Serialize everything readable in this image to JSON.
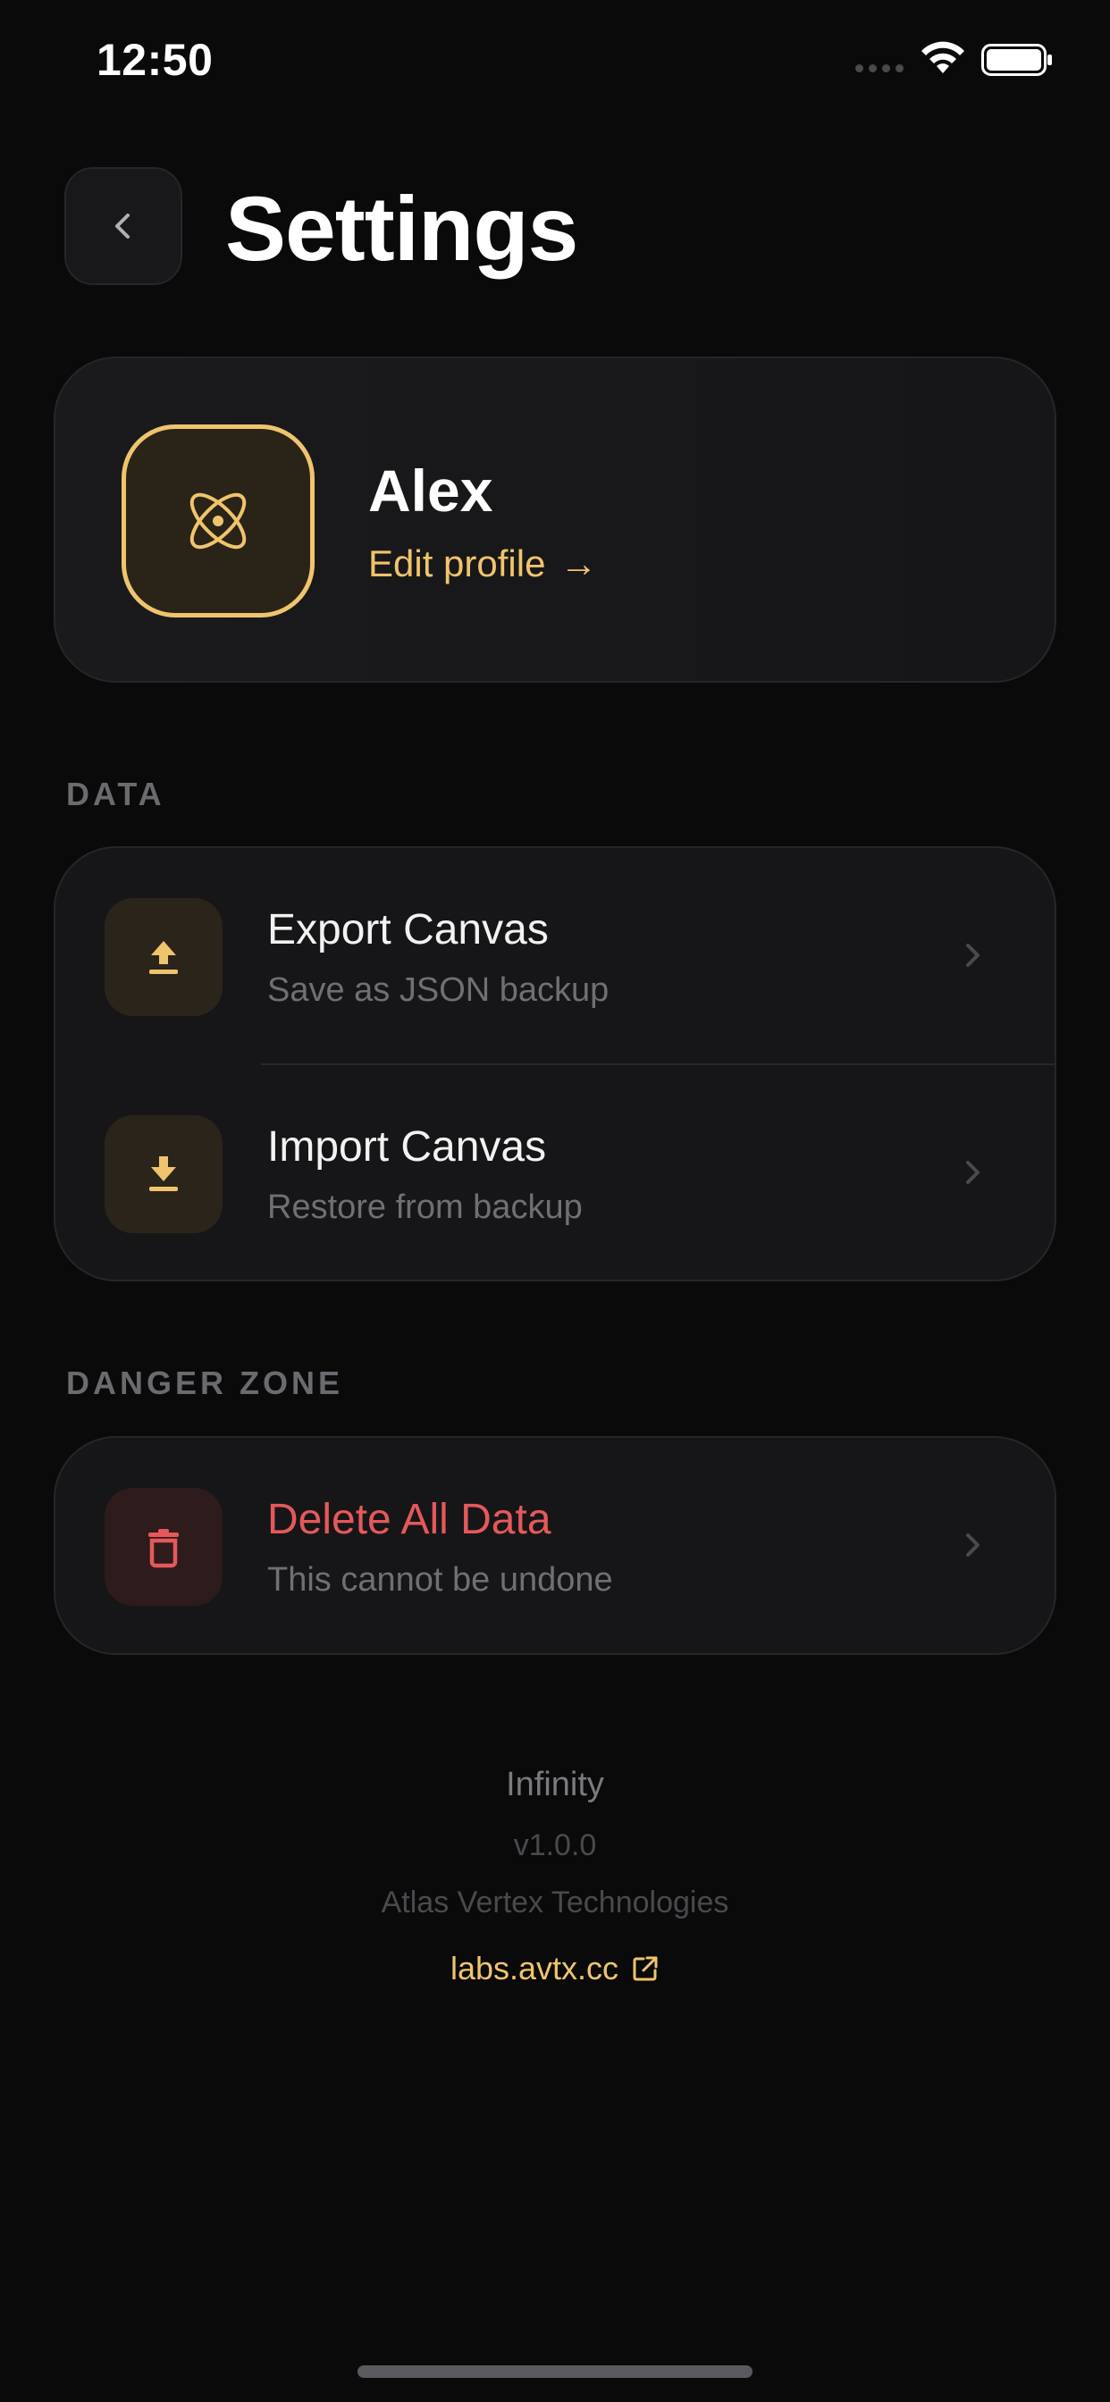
{
  "status_bar": {
    "time": "12:50"
  },
  "header": {
    "title": "Settings"
  },
  "profile": {
    "name": "Alex",
    "edit_label": "Edit profile",
    "edit_arrow": "→"
  },
  "sections": {
    "data": {
      "label": "DATA",
      "items": [
        {
          "title": "Export Canvas",
          "subtitle": "Save as JSON backup",
          "icon": "upload-icon"
        },
        {
          "title": "Import Canvas",
          "subtitle": "Restore from backup",
          "icon": "download-icon"
        }
      ]
    },
    "danger": {
      "label": "DANGER ZONE",
      "items": [
        {
          "title": "Delete All Data",
          "subtitle": "This cannot be undone",
          "icon": "trash-icon"
        }
      ]
    }
  },
  "footer": {
    "app_name": "Infinity",
    "version": "v1.0.0",
    "company": "Atlas Vertex Technologies",
    "link": "labs.avtx.cc"
  },
  "colors": {
    "background": "#0a0a0b",
    "accent": "#f0c46c",
    "danger": "#e5595a",
    "card": "#161618"
  }
}
